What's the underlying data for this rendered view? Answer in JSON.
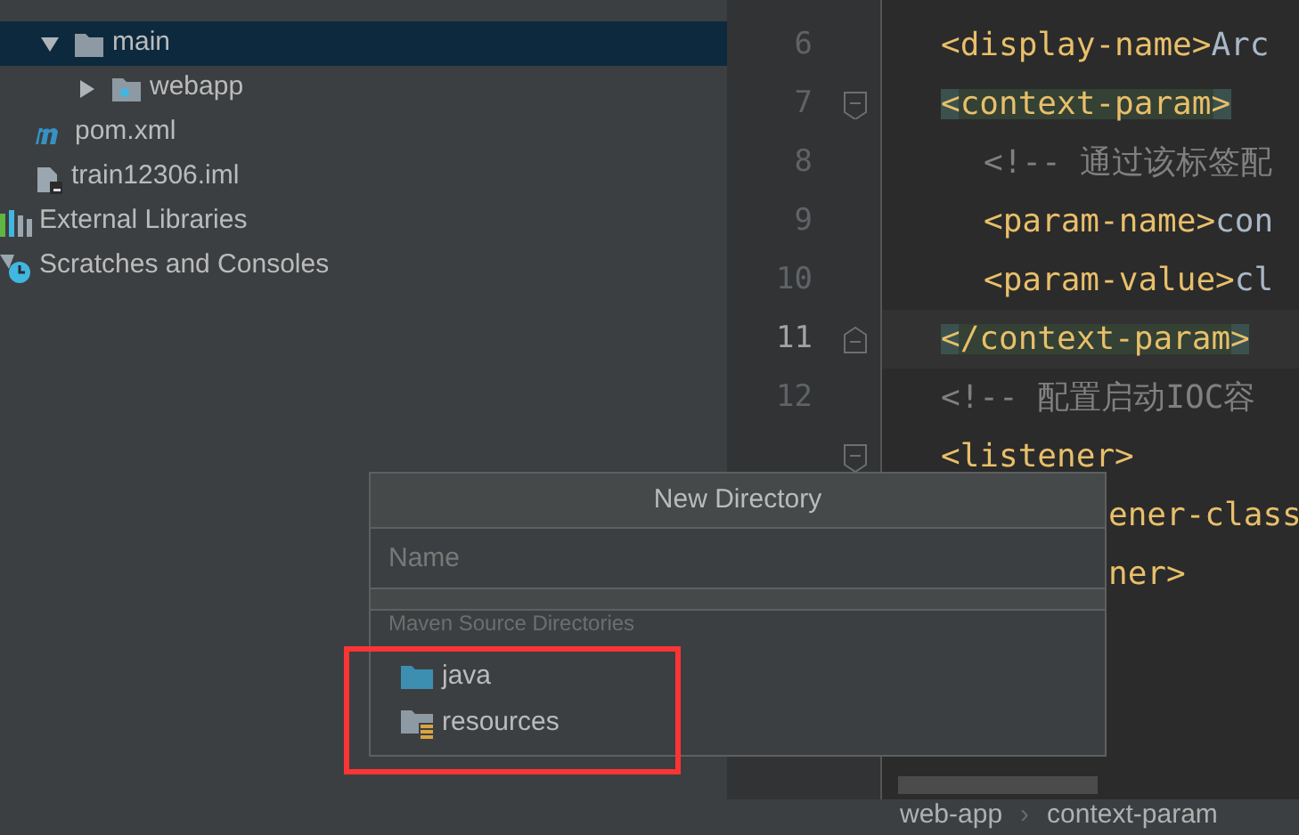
{
  "project_tree": [
    {
      "label": "main",
      "kind": "folder",
      "expanded": true,
      "selected": true,
      "children": [
        {
          "label": "webapp",
          "kind": "web-folder",
          "expanded": false,
          "selected": false
        }
      ]
    },
    {
      "label": "pom.xml",
      "kind": "maven",
      "selected": false
    },
    {
      "label": "train12306.iml",
      "kind": "module-file",
      "selected": false
    },
    {
      "label": "External Libraries",
      "kind": "libraries",
      "selected": false
    },
    {
      "label": "Scratches and Consoles",
      "kind": "scratches",
      "selected": false
    }
  ],
  "editor": {
    "lines": [
      {
        "number": "6",
        "current": false,
        "fold": false,
        "nested": false,
        "covered": false,
        "segments": [
          {
            "kind": "tag",
            "text": "<display-name>",
            "matched": false
          },
          {
            "kind": "text",
            "text": "Arc",
            "matched": false
          }
        ]
      },
      {
        "number": "7",
        "current": false,
        "fold": true,
        "nested": false,
        "covered": false,
        "segments": [
          {
            "kind": "tag",
            "text": "<context-param>",
            "matched": true
          }
        ]
      },
      {
        "number": "8",
        "current": false,
        "fold": false,
        "nested": true,
        "covered": false,
        "segments": [
          {
            "kind": "comment",
            "text": "<!-- 通过该标签配",
            "matched": false
          }
        ]
      },
      {
        "number": "9",
        "current": false,
        "fold": false,
        "nested": true,
        "covered": false,
        "segments": [
          {
            "kind": "tag",
            "text": "<param-name>",
            "matched": false
          },
          {
            "kind": "text",
            "text": "con",
            "matched": false
          }
        ]
      },
      {
        "number": "10",
        "current": false,
        "fold": false,
        "nested": true,
        "covered": false,
        "segments": [
          {
            "kind": "tag",
            "text": "<param-value>",
            "matched": false
          },
          {
            "kind": "text",
            "text": "cl",
            "matched": false
          }
        ]
      },
      {
        "number": "11",
        "current": true,
        "fold": true,
        "nested": false,
        "covered": false,
        "segments": [
          {
            "kind": "tag",
            "text": "</context-param>",
            "matched": true
          }
        ]
      },
      {
        "number": "12",
        "current": false,
        "fold": false,
        "nested": false,
        "covered": false,
        "segments": [
          {
            "kind": "comment",
            "text": "<!-- 配置启动IOC容",
            "matched": false
          }
        ]
      },
      {
        "current": false,
        "fold": true,
        "nested": false,
        "covered": false,
        "segments": [
          {
            "kind": "tag",
            "text": "<listener>",
            "matched": false
          }
        ]
      },
      {
        "current": false,
        "fold": false,
        "nested": true,
        "covered": true,
        "segments": [
          {
            "kind": "tag",
            "text": "ener-class",
            "matched": false
          }
        ]
      },
      {
        "current": false,
        "fold": false,
        "nested": false,
        "covered": true,
        "segments": [
          {
            "kind": "tag",
            "text": "ner>",
            "matched": false
          }
        ]
      }
    ],
    "breadcrumbs": [
      "web-app",
      "context-param"
    ],
    "breadcrumb_separator": "›"
  },
  "dialog": {
    "title": "New Directory",
    "name_field": {
      "placeholder": "Name"
    },
    "section_label": "Maven Source Directories",
    "items": [
      {
        "label": "java",
        "kind": "source-folder"
      },
      {
        "label": "resources",
        "kind": "resources-folder"
      }
    ]
  }
}
